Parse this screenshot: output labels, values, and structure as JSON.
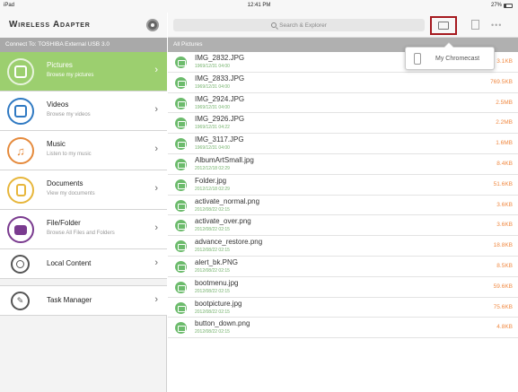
{
  "status_bar": {
    "device": "iPad",
    "time": "12:41 PM",
    "battery": "27%"
  },
  "app": {
    "title": "Wireless Adapter"
  },
  "connect_bar": "Connect To: TOSHIBA External USB 3.0",
  "nav": [
    {
      "title": "Pictures",
      "subtitle": "Browse my pictures",
      "icon": "picture-icon",
      "color": "#9ccf6f",
      "active": true
    },
    {
      "title": "Videos",
      "subtitle": "Browse my videos",
      "icon": "film-icon",
      "color": "#2f79c2"
    },
    {
      "title": "Music",
      "subtitle": "Listen to my music",
      "icon": "music-note-icon",
      "color": "#e58a3c"
    },
    {
      "title": "Documents",
      "subtitle": "View my documents",
      "icon": "document-icon",
      "color": "#e7b63b"
    },
    {
      "title": "File/Folder",
      "subtitle": "Browse All Files and Folders",
      "icon": "folder-icon",
      "color": "#7a3b8f"
    },
    {
      "title": "Local Content",
      "icon": "local-content-icon"
    },
    {
      "title": "Task Manager",
      "icon": "task-manager-icon"
    }
  ],
  "search": {
    "placeholder": "Search & Explorer"
  },
  "section_title": "All Pictures",
  "popup": {
    "label": "My Chromecast"
  },
  "files": [
    {
      "name": "IMG_2832.JPG",
      "date": "1969/12/31 04:00",
      "size": "3.1KB"
    },
    {
      "name": "IMG_2833.JPG",
      "date": "1969/12/31 04:00",
      "size": "769.5KB"
    },
    {
      "name": "IMG_2924.JPG",
      "date": "1969/12/31 04:00",
      "size": "2.5MB"
    },
    {
      "name": "IMG_2926.JPG",
      "date": "1969/12/31 04:22",
      "size": "2.2MB"
    },
    {
      "name": "IMG_3117.JPG",
      "date": "1969/12/31 04:00",
      "size": "1.6MB"
    },
    {
      "name": "AlbumArtSmall.jpg",
      "date": "2012/12/18 02:29",
      "size": "8.4KB"
    },
    {
      "name": "Folder.jpg",
      "date": "2012/12/18 02:29",
      "size": "51.6KB"
    },
    {
      "name": "activate_normal.png",
      "date": "2012/08/22 02:15",
      "size": "3.6KB"
    },
    {
      "name": "activate_over.png",
      "date": "2012/08/22 02:15",
      "size": "3.6KB"
    },
    {
      "name": "advance_restore.png",
      "date": "2012/08/22 02:15",
      "size": "18.8KB"
    },
    {
      "name": "alert_bk.PNG",
      "date": "2012/08/22 02:15",
      "size": "8.5KB"
    },
    {
      "name": "bootmenu.jpg",
      "date": "2012/08/22 02:15",
      "size": "59.6KB"
    },
    {
      "name": "bootpicture.jpg",
      "date": "2012/08/22 02:15",
      "size": "75.6KB"
    },
    {
      "name": "button_down.png",
      "date": "2012/08/22 02:15",
      "size": "4.8KB"
    }
  ]
}
